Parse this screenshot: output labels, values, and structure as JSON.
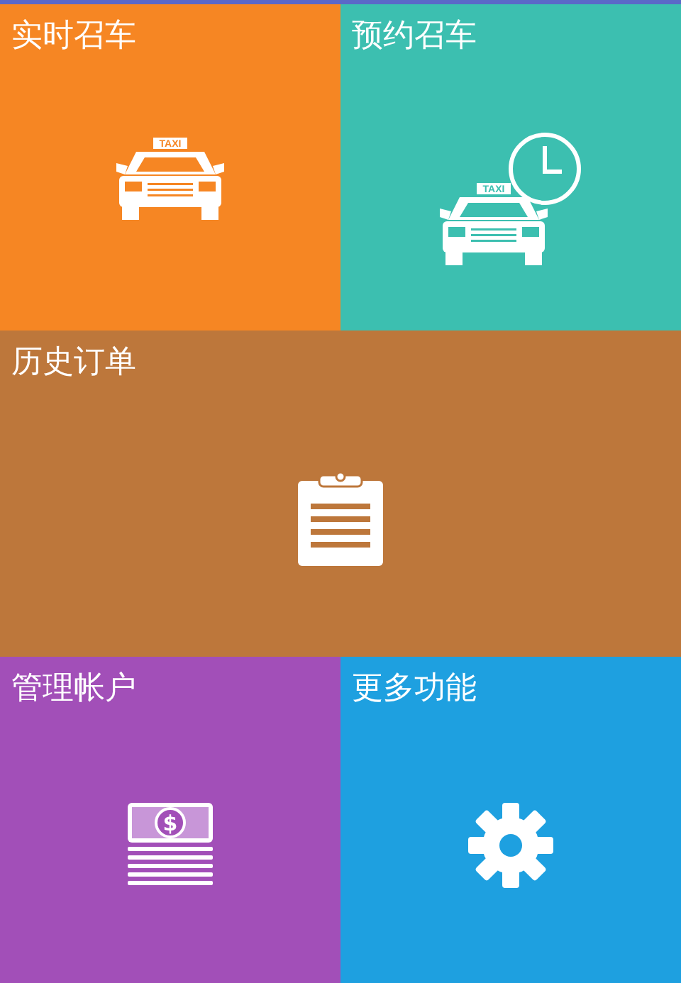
{
  "tiles": [
    {
      "label": "实时召车",
      "color": "#f68623",
      "wide": false,
      "icon": {
        "kind": "taxi",
        "sign": "TAXI"
      }
    },
    {
      "label": "预约召车",
      "color": "#3cbfb0",
      "wide": false,
      "icon": {
        "kind": "taxi-clock",
        "sign": "TAXI"
      }
    },
    {
      "label": "历史订单",
      "color": "#bd773b",
      "wide": true,
      "icon": {
        "kind": "clipboard"
      }
    },
    {
      "label": "管理帐户",
      "color": "#a24fb8",
      "wide": false,
      "icon": {
        "kind": "money",
        "symbol": "$"
      }
    },
    {
      "label": "更多功能",
      "color": "#1ea0e0",
      "wide": false,
      "icon": {
        "kind": "gear"
      }
    }
  ]
}
